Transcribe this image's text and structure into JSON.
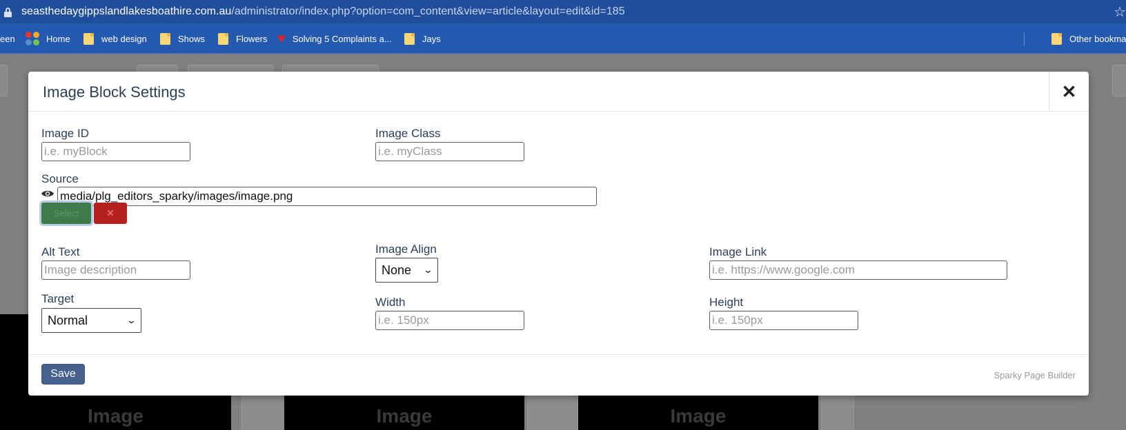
{
  "browser": {
    "url_host": "seasthedaygippslandlakesboathire.com.au",
    "url_path": "/administrator/index.php?option=com_content&view=article&layout=edit&id=185",
    "bookmarks": [
      {
        "label": "een",
        "icon": "none"
      },
      {
        "label": "Home",
        "icon": "joomla-icon"
      },
      {
        "label": "web design",
        "icon": "folder-icon"
      },
      {
        "label": "Shows",
        "icon": "folder-icon"
      },
      {
        "label": "Flowers",
        "icon": "folder-icon"
      },
      {
        "label": "Solving 5 Complaints a...",
        "icon": "heart-icon"
      },
      {
        "label": "Jays",
        "icon": "folder-icon"
      }
    ],
    "other_bookmarks": "Other bookmar"
  },
  "background": {
    "ghost_text": "Image"
  },
  "modal": {
    "title": "Image Block Settings",
    "close_symbol": "✕",
    "fields": {
      "image_id": {
        "label": "Image ID",
        "placeholder": "i.e. myBlock",
        "value": ""
      },
      "image_class": {
        "label": "Image Class",
        "placeholder": "i.e. myClass",
        "value": ""
      },
      "source": {
        "label": "Source",
        "value": "media/plg_editors_sparky/images/image.png"
      },
      "alt_text": {
        "label": "Alt Text",
        "placeholder": "Image description",
        "value": ""
      },
      "image_align": {
        "label": "Image Align",
        "selected": "None"
      },
      "image_link": {
        "label": "Image Link",
        "placeholder": "i.e. https://www.google.com",
        "value": ""
      },
      "target": {
        "label": "Target",
        "selected": "Normal"
      },
      "width": {
        "label": "Width",
        "placeholder": "i.e. 150px",
        "value": ""
      },
      "height": {
        "label": "Height",
        "placeholder": "i.e. 150px",
        "value": ""
      }
    },
    "source_buttons": {
      "select_label": "Select",
      "clear_label": "✕"
    },
    "footer": {
      "save_label": "Save",
      "brand": "Sparky Page Builder"
    }
  }
}
